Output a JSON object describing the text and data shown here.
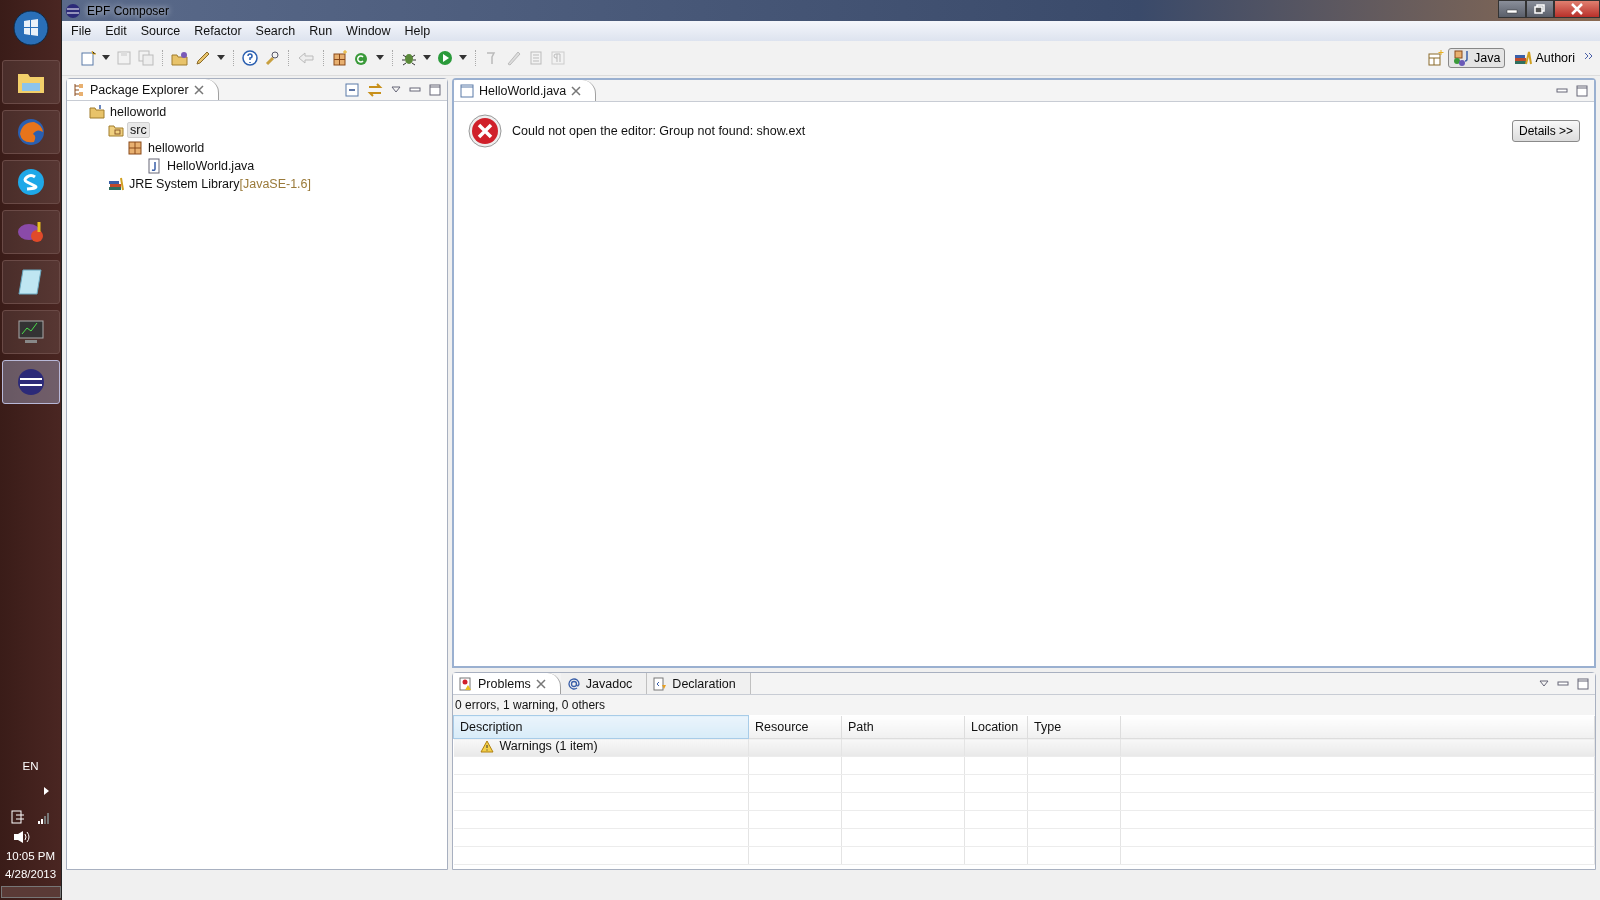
{
  "taskbar": {
    "apps": [
      {
        "kind": "folder",
        "selected": false
      },
      {
        "kind": "browser",
        "selected": false
      },
      {
        "kind": "chat",
        "selected": false
      },
      {
        "kind": "messenger",
        "selected": false
      },
      {
        "kind": "notes",
        "selected": false
      },
      {
        "kind": "monitor",
        "selected": false
      },
      {
        "kind": "ide",
        "selected": true
      }
    ],
    "language": "EN",
    "time": "10:05 PM",
    "date": "4/28/2013"
  },
  "window": {
    "title": "EPF Composer"
  },
  "menu": [
    "File",
    "Edit",
    "Source",
    "Refactor",
    "Search",
    "Run",
    "Window",
    "Help"
  ],
  "perspectives": [
    {
      "label": "Java",
      "selected": true
    },
    {
      "label": "Authori",
      "selected": false
    }
  ],
  "package_explorer": {
    "title": "Package Explorer",
    "tree": [
      {
        "label": "helloworld",
        "kind": "project",
        "selected": false,
        "children": [
          {
            "label": "src",
            "kind": "source-folder",
            "selected": true,
            "children": [
              {
                "label": "helloworld",
                "kind": "package",
                "selected": false,
                "children": [
                  {
                    "label": "HelloWorld.java",
                    "kind": "java-file",
                    "selected": false
                  }
                ]
              }
            ]
          },
          {
            "label": "JRE System Library",
            "decoration": "[JavaSE-1.6]",
            "kind": "library",
            "selected": false
          }
        ]
      }
    ]
  },
  "editor": {
    "tab": "HelloWorld.java",
    "message": "Could not open the editor: Group not found: show.ext",
    "details_button": "Details >>"
  },
  "bottom_panel": {
    "tabs": [
      {
        "label": "Problems",
        "kind": "problems",
        "selected": true
      },
      {
        "label": "Javadoc",
        "kind": "javadoc",
        "selected": false
      },
      {
        "label": "Declaration",
        "kind": "declaration",
        "selected": false
      }
    ],
    "summary": "0 errors, 1 warning, 0 others",
    "columns": [
      "Description",
      "Resource",
      "Path",
      "Location",
      "Type"
    ],
    "rows": [
      {
        "description": "Warnings (1 item)",
        "kind": "warning-group"
      }
    ]
  }
}
